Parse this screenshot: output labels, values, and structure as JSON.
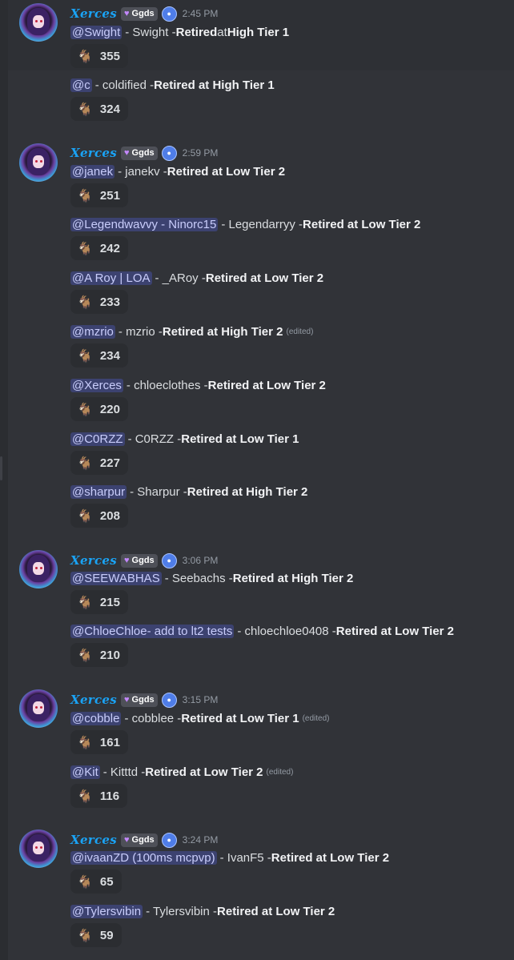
{
  "author": {
    "name": "Xerces",
    "tag": "Ggds",
    "tag_icon": "heart-icon",
    "badge_icon": "app-badge-icon"
  },
  "reaction_icon": "goat-emoji",
  "groups": [
    {
      "time": "2:45 PM",
      "messages": [
        {
          "mention": "@Swight",
          "parts": [
            " - Swight - ",
            "Retired",
            " at ",
            "High Tier 1"
          ],
          "reactions": "355",
          "edited": ""
        },
        {
          "mention": "@c",
          "parts": [
            " - coldified - ",
            "Retired at High Tier 1"
          ],
          "reactions": "324",
          "edited": ""
        }
      ]
    },
    {
      "time": "2:59 PM",
      "messages": [
        {
          "mention": "@janek",
          "parts": [
            " - janekv - ",
            "Retired at Low Tier 2"
          ],
          "reactions": "251",
          "edited": ""
        },
        {
          "mention": "@Legendwavvy - Ninorc15",
          "parts": [
            "  - Legendarryy - ",
            "Retired at Low Tier 2"
          ],
          "reactions": "242",
          "edited": ""
        },
        {
          "mention": "@A Roy | LOA",
          "parts": [
            "   - _ARoy - ",
            "Retired at Low Tier 2"
          ],
          "reactions": "233",
          "edited": ""
        },
        {
          "mention": "@mzrio",
          "parts": [
            "   - mzrio - ",
            "Retired at High Tier 2"
          ],
          "reactions": "234",
          "edited": "(edited)"
        },
        {
          "mention": "@Xerces",
          "parts": [
            " - chloeclothes - ",
            "Retired at Low Tier 2"
          ],
          "reactions": "220",
          "edited": ""
        },
        {
          "mention": "@C0RZZ",
          "parts": [
            " -  C0RZZ -  ",
            "Retired at Low Tier 1"
          ],
          "reactions": "227",
          "edited": ""
        },
        {
          "mention": "@sharpur",
          "parts": [
            " -  Sharpur -  ",
            "Retired at  High Tier 2"
          ],
          "reactions": "208",
          "edited": ""
        }
      ]
    },
    {
      "time": "3:06 PM",
      "messages": [
        {
          "mention": "@SEEWABHAS",
          "parts": [
            " - Seebachs -  ",
            "Retired at High Tier 2"
          ],
          "reactions": "215",
          "edited": ""
        },
        {
          "mention": "@ChloeChloe- add to lt2 tests",
          "parts": [
            " -  chloechloe0408 -  ",
            "Retired at Low Tier 2"
          ],
          "reactions": "210",
          "edited": ""
        }
      ]
    },
    {
      "time": "3:15 PM",
      "messages": [
        {
          "mention": "@cobble",
          "parts": [
            " - cobblee -  ",
            "Retired at Low Tier 1"
          ],
          "reactions": "161",
          "edited": "(edited)"
        },
        {
          "mention": "@Kit",
          "parts": [
            " -  Kitttd -  ",
            "Retired at Low Tier 2"
          ],
          "reactions": "116",
          "edited": "(edited)"
        }
      ]
    },
    {
      "time": "3:24 PM",
      "messages": [
        {
          "mention": "@ivaanZD (100ms mcpvp)",
          "parts": [
            " - IvanF5 - ",
            "Retired at Low Tier 2"
          ],
          "reactions": "65",
          "edited": ""
        },
        {
          "mention": "@Tylersvibin",
          "parts": [
            " -  Tylersvibin -  ",
            "Retired at Low Tier 2"
          ],
          "reactions": "59",
          "edited": ""
        }
      ]
    }
  ]
}
